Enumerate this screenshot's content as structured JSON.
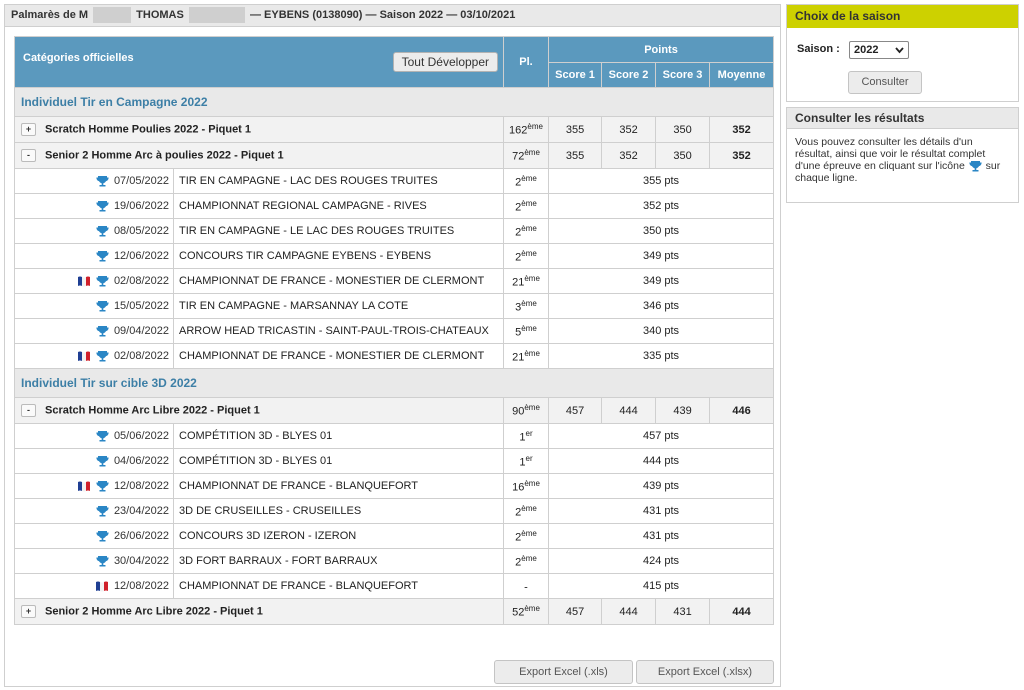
{
  "header": {
    "prefix": "Palmarès de M",
    "name": "THOMAS",
    "suffix": "— EYBENS (0138090) — Saison 2022 — 03/10/2021"
  },
  "table_header": {
    "categories": "Catégories officielles",
    "expand_all": "Tout Développer",
    "pl": "Pl.",
    "points": "Points",
    "score1": "Score 1",
    "score2": "Score 2",
    "score3": "Score 3",
    "moyenne": "Moyenne"
  },
  "sections": [
    {
      "title": "Individuel Tir en Campagne 2022"
    },
    {
      "title": "Individuel Tir sur cible 3D 2022"
    }
  ],
  "categories": [
    {
      "toggle": "+",
      "name": "Scratch Homme Poulies 2022 - Piquet 1",
      "rank": "162",
      "sup": "ème",
      "s1": "355",
      "s2": "352",
      "s3": "350",
      "avg": "352"
    },
    {
      "toggle": "-",
      "name": "Senior 2 Homme Arc à poulies 2022 - Piquet 1",
      "rank": "72",
      "sup": "ème",
      "s1": "355",
      "s2": "352",
      "s3": "350",
      "avg": "352"
    },
    {
      "toggle": "-",
      "name": "Scratch Homme Arc Libre 2022 - Piquet 1",
      "rank": "90",
      "sup": "ème",
      "s1": "457",
      "s2": "444",
      "s3": "439",
      "avg": "446"
    },
    {
      "toggle": "+",
      "name": "Senior 2 Homme Arc Libre 2022 - Piquet 1",
      "rank": "52",
      "sup": "ème",
      "s1": "457",
      "s2": "444",
      "s3": "431",
      "avg": "444"
    }
  ],
  "events_a": [
    {
      "date": "07/05/2022",
      "name": "TIR EN CAMPAGNE - LAC DES ROUGES TRUITES",
      "rank": "2",
      "sup": "ème",
      "pts": "355 pts"
    },
    {
      "date": "19/06/2022",
      "name": "CHAMPIONNAT REGIONAL CAMPAGNE - RIVES",
      "rank": "2",
      "sup": "ème",
      "pts": "352 pts"
    },
    {
      "date": "08/05/2022",
      "name": "TIR EN CAMPAGNE - LE LAC DES ROUGES TRUITES",
      "rank": "2",
      "sup": "ème",
      "pts": "350 pts"
    },
    {
      "date": "12/06/2022",
      "name": "CONCOURS TIR CAMPAGNE EYBENS - EYBENS",
      "rank": "2",
      "sup": "ème",
      "pts": "349 pts"
    },
    {
      "date": "02/08/2022",
      "name": "CHAMPIONNAT DE FRANCE - MONESTIER DE CLERMONT",
      "rank": "21",
      "sup": "ème",
      "pts": "349 pts"
    },
    {
      "date": "15/05/2022",
      "name": "TIR EN CAMPAGNE - MARSANNAY LA COTE",
      "rank": "3",
      "sup": "ème",
      "pts": "346 pts"
    },
    {
      "date": "09/04/2022",
      "name": "ARROW HEAD TRICASTIN - SAINT-PAUL-TROIS-CHATEAUX",
      "rank": "5",
      "sup": "ème",
      "pts": "340 pts"
    },
    {
      "date": "02/08/2022",
      "name": "CHAMPIONNAT DE FRANCE - MONESTIER DE CLERMONT",
      "rank": "21",
      "sup": "ème",
      "pts": "335 pts"
    }
  ],
  "events_b": [
    {
      "date": "05/06/2022",
      "name": "COMPÉTITION 3D - BLYES 01",
      "rank": "1",
      "sup": "er",
      "pts": "457 pts"
    },
    {
      "date": "04/06/2022",
      "name": "COMPÉTITION 3D - BLYES 01",
      "rank": "1",
      "sup": "er",
      "pts": "444 pts"
    },
    {
      "date": "12/08/2022",
      "name": "CHAMPIONNAT DE FRANCE - BLANQUEFORT",
      "rank": "16",
      "sup": "ème",
      "pts": "439 pts"
    },
    {
      "date": "23/04/2022",
      "name": "3D DE CRUSEILLES - CRUSEILLES",
      "rank": "2",
      "sup": "ème",
      "pts": "431 pts"
    },
    {
      "date": "26/06/2022",
      "name": "CONCOURS 3D IZERON - IZERON",
      "rank": "2",
      "sup": "ème",
      "pts": "431 pts"
    },
    {
      "date": "30/04/2022",
      "name": "3D FORT BARRAUX - FORT BARRAUX",
      "rank": "2",
      "sup": "ème",
      "pts": "424 pts"
    },
    {
      "date": "12/08/2022",
      "name": "CHAMPIONNAT DE FRANCE - BLANQUEFORT",
      "rank": "-",
      "sup": "",
      "pts": "415 pts"
    }
  ],
  "export": {
    "xls": "Export Excel (.xls)",
    "xlsx": "Export Excel (.xlsx)"
  },
  "season": {
    "title": "Choix de la saison",
    "label": "Saison :",
    "value": "2022",
    "button": "Consulter"
  },
  "results": {
    "title": "Consulter les résultats",
    "text1": "Vous pouvez consulter les détails d'un résultat, ainsi que voir le résultat complet d'une épreuve en cliquant sur l'icône",
    "text2": "sur chaque ligne."
  },
  "colors": {
    "header_blue": "#5b99be",
    "section_text": "#3d7fa6",
    "season_bar": "#cdd100",
    "trophy": "#2a86c5"
  }
}
